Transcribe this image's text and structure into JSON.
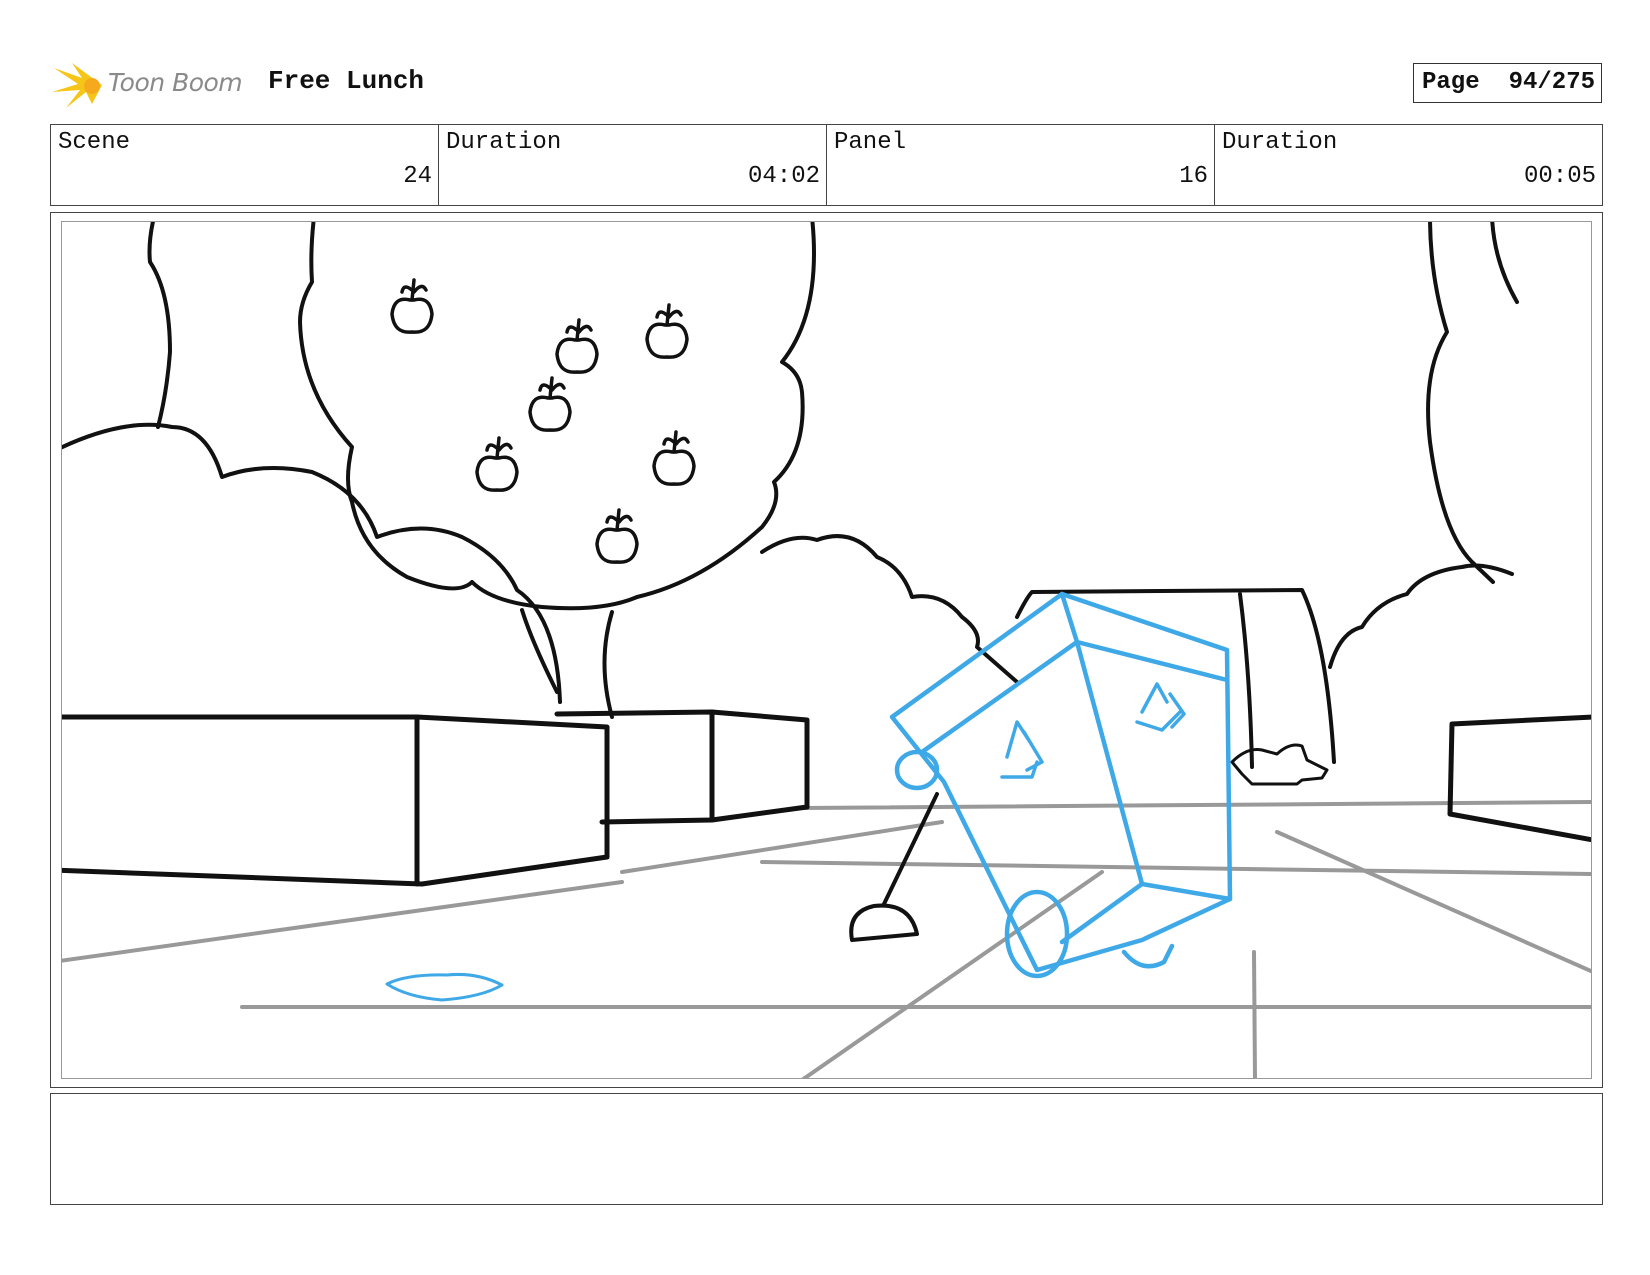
{
  "header": {
    "logo_text": "Toon Boom",
    "project_title": "Free Lunch",
    "page_label": "Page",
    "page_value": "94/275"
  },
  "info_bar": [
    {
      "label": "Scene",
      "value": "24"
    },
    {
      "label": "Duration",
      "value": "04:02"
    },
    {
      "label": "Panel",
      "value": "16"
    },
    {
      "label": "Duration",
      "value": "00:05"
    }
  ],
  "colors": {
    "sketch_line": "#111111",
    "perspective_line": "#999999",
    "character_blue": "#3fa9e8",
    "logo_yellow": "#f5c518"
  },
  "notes": ""
}
